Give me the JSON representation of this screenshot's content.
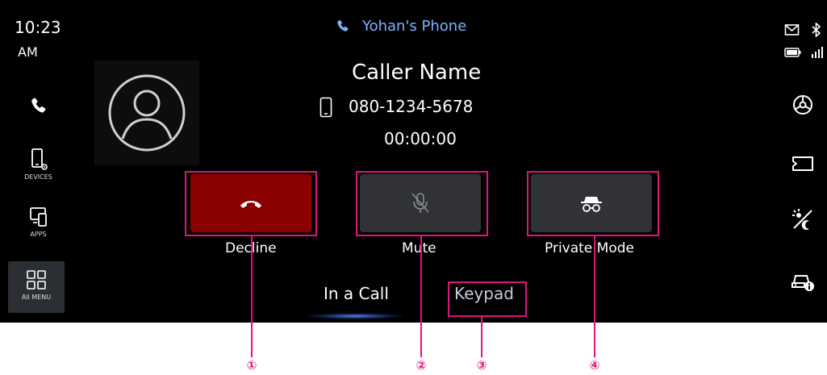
{
  "status": {
    "time": "10:23",
    "ampm": "AM",
    "phone_name": "Yohan's Phone"
  },
  "left_nav": {
    "devices_label": "DEVICES",
    "apps_label": "APPS",
    "all_menu_label": "All MENU"
  },
  "caller": {
    "name": "Caller Name",
    "number": "080-1234-5678",
    "timer": "00:00:00"
  },
  "actions": {
    "decline_label": "Decline",
    "mute_label": "Mute",
    "private_label": "Private Mode"
  },
  "tabs": {
    "in_call": "In a Call",
    "keypad": "Keypad"
  },
  "callouts": [
    "①",
    "②",
    "③",
    "④"
  ],
  "colors": {
    "decline": "#8b0000",
    "accent": "#7fb2ff",
    "highlight": "#e0137f"
  },
  "icons": [
    "phone-icon",
    "mail-icon",
    "bluetooth-icon",
    "battery-icon",
    "signal-icon",
    "devices-icon",
    "apps-icon",
    "all-menu-icon",
    "settings-icon",
    "display-icon",
    "brightness-icon",
    "car-info-icon",
    "avatar-icon",
    "mobile-icon",
    "hang-up-icon",
    "mic-off-icon",
    "incognito-icon"
  ]
}
